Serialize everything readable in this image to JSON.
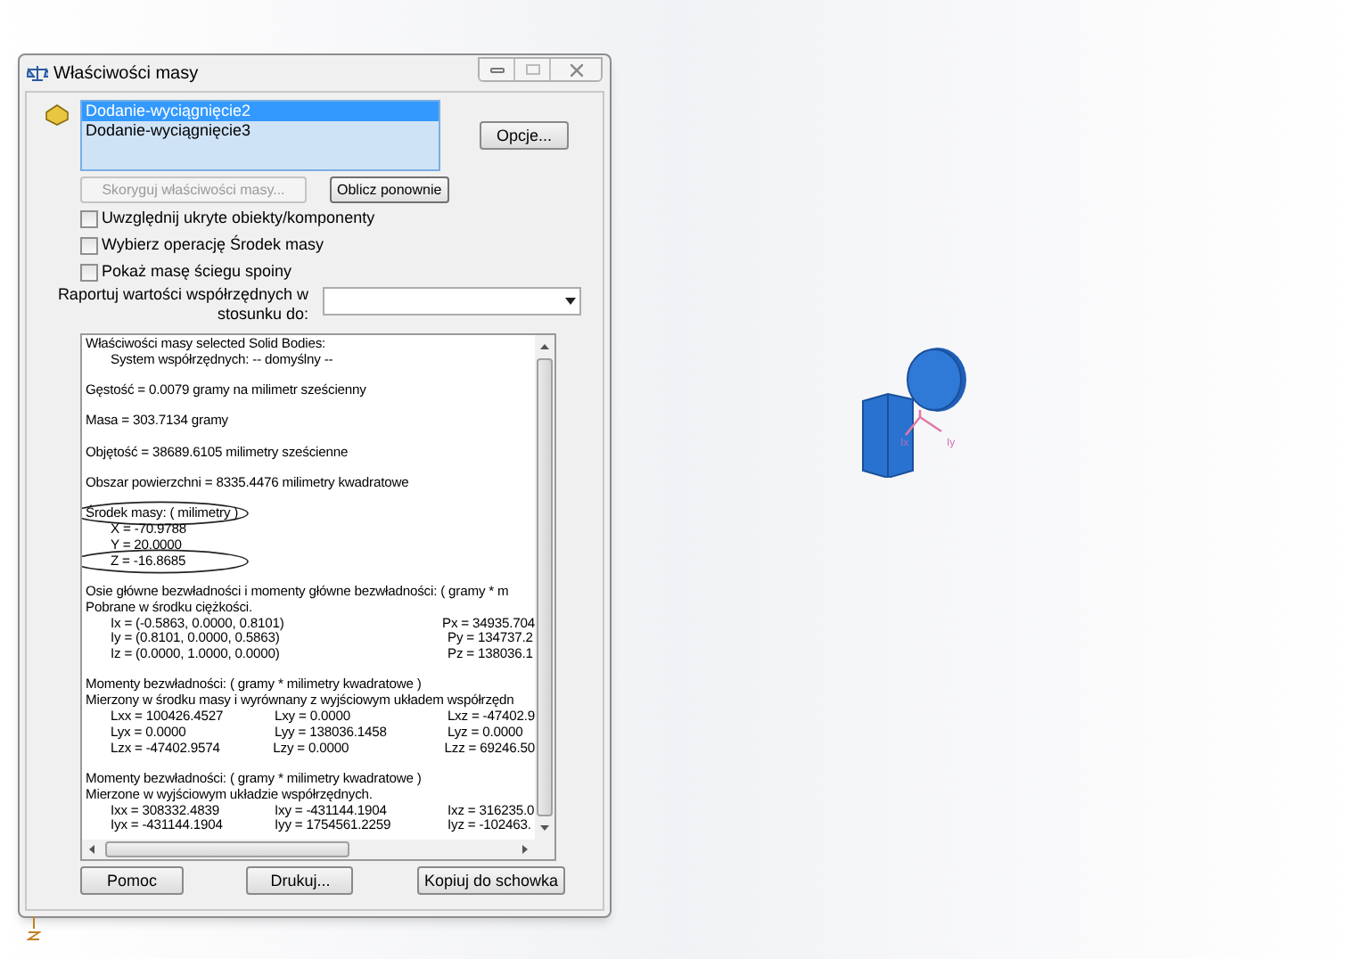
{
  "window": {
    "title": "Właściwości masy"
  },
  "selection_list": [
    {
      "label": "Dodanie-wyciągnięcie2",
      "selected": true
    },
    {
      "label": "Dodanie-wyciągnięcie3",
      "selected": false
    }
  ],
  "options_button": "Opcje...",
  "action_buttons": [
    {
      "label": "Skoryguj właściwości masy...",
      "disabled": true
    },
    {
      "label": "Oblicz ponownie",
      "disabled": false
    }
  ],
  "checkboxes": [
    {
      "label": "Uwzględnij ukryte obiekty/komponenty",
      "checked": false
    },
    {
      "label": "Wybierz operację Środek masy",
      "checked": false
    },
    {
      "label": "Pokaż masę ściegu spoiny",
      "checked": false
    }
  ],
  "report_relative": {
    "label": "Raportuj wartości współrzędnych w stosunku do:"
  },
  "report": [
    [
      {
        "kind": "text",
        "text": "Właściwości masy selected Solid Bodies:"
      },
      {
        "kind": "indented",
        "text": "System współrzędnych: -- domyślny --"
      }
    ],
    [
      {
        "kind": "text",
        "text": "Gęstość = 0.0079 gramy na milimetr sześcienny"
      }
    ],
    [
      {
        "kind": "text",
        "text": "Masa = 303.7134 gramy"
      }
    ],
    [
      {
        "kind": "text",
        "text": "Objętość = 38689.6105 milimetry sześcienne"
      }
    ],
    [
      {
        "kind": "text",
        "text": "Obszar powierzchni = 8335.4476  milimetry kwadratowe"
      }
    ],
    [
      {
        "kind": "text",
        "text": "Środek masy: ( milimetry )",
        "circled": true
      },
      {
        "kind": "indented",
        "text": "X = -70.9788",
        "circled": false
      },
      {
        "kind": "indented",
        "text": "Y = 20.0000",
        "circled": false
      },
      {
        "kind": "indented",
        "text": "Z = -16.8685",
        "circled": true
      }
    ],
    [
      {
        "kind": "text",
        "text": "Osie główne bezwładności i momenty główne bezwładności: ( gramy *  m"
      },
      {
        "kind": "text",
        "text": "Pobrane w środku ciężkości."
      },
      {
        "kind": "pair",
        "cells": [
          "Ix = (-0.5863, 0.0000, 0.8101)",
          "Px = 34935.704"
        ]
      },
      {
        "kind": "pair",
        "cells": [
          "Iy = (0.8101, 0.0000, 0.5863)",
          "Py = 134737.2"
        ]
      },
      {
        "kind": "pair",
        "cells": [
          "Iz = (0.0000, 1.0000, 0.0000)",
          "Pz = 138036.1"
        ]
      }
    ],
    [
      {
        "kind": "text",
        "text": "Momenty bezwładności: ( gramy *  milimetry kwadratowe )"
      },
      {
        "kind": "text",
        "text": "Mierzony w środku masy i wyrównany z wyjściowym układem współrzędn"
      },
      {
        "kind": "row",
        "cells": [
          "Lxx = 100426.4527",
          "Lxy = 0.0000",
          "Lxz = -47402.9"
        ]
      },
      {
        "kind": "row",
        "cells": [
          "Lyx = 0.0000",
          "Lyy = 138036.1458",
          "Lyz = 0.0000"
        ]
      },
      {
        "kind": "row",
        "cells": [
          "Lzx = -47402.9574",
          "Lzy = 0.0000",
          "Lzz = 69246.50"
        ]
      }
    ],
    [
      {
        "kind": "text",
        "text": "Momenty bezwładności: ( gramy *  milimetry kwadratowe )"
      },
      {
        "kind": "text",
        "text": "Mierzone w wyjściowym układzie współrzędnych."
      },
      {
        "kind": "row",
        "cells": [
          "Ixx = 308332.4839",
          "Ixy = -431144.1904",
          "Ixz = 316235.0"
        ]
      },
      {
        "kind": "row",
        "cells": [
          "Iyx = -431144.1904",
          "Iyy = 1754561.2259",
          "Iyz = -102463."
        ]
      }
    ]
  ],
  "footer_buttons": [
    "Pomoc",
    "Drukuj...",
    "Kopiuj do schowka"
  ],
  "model": {
    "axis_labels": [
      "Ix",
      "Iy"
    ]
  }
}
